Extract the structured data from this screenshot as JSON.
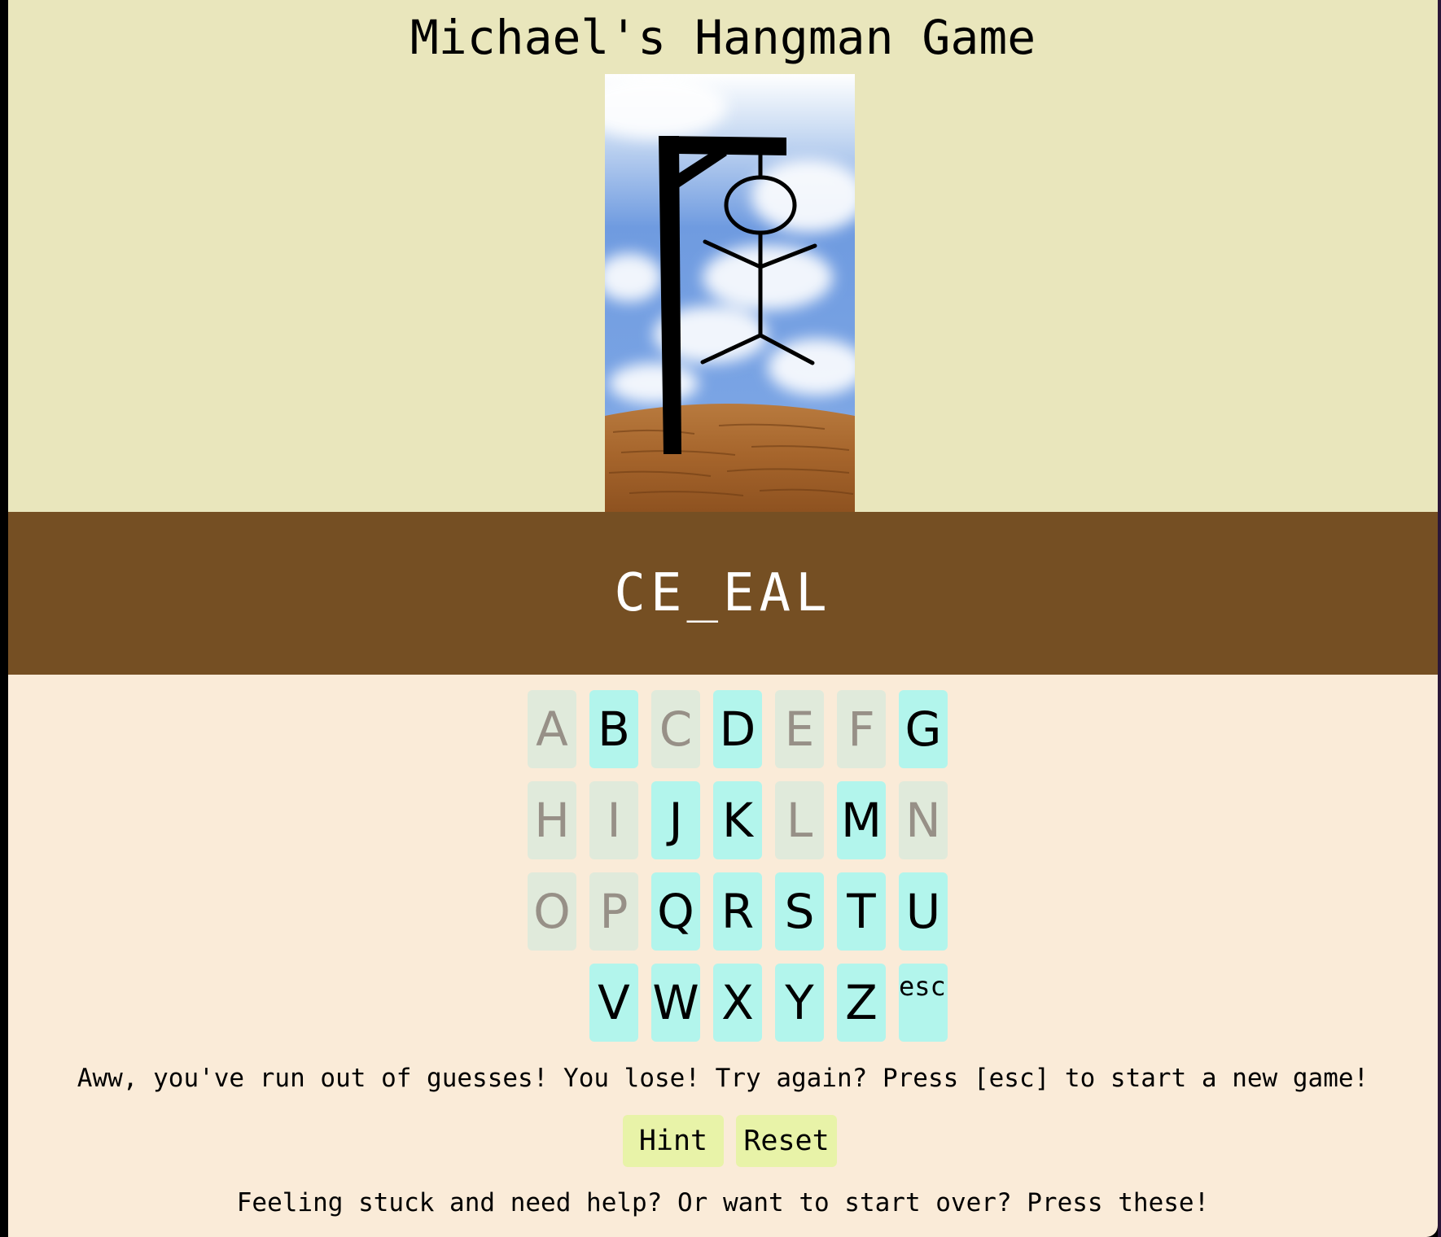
{
  "page": {
    "title": "Michael's Hangman Game"
  },
  "game": {
    "word_display": "CE_EAL",
    "image": "gallows-with-full-stick-figure"
  },
  "keyboard": {
    "rows": [
      [
        {
          "label": "A",
          "used": true
        },
        {
          "label": "B",
          "used": false
        },
        {
          "label": "C",
          "used": true
        },
        {
          "label": "D",
          "used": false
        },
        {
          "label": "E",
          "used": true
        },
        {
          "label": "F",
          "used": true
        },
        {
          "label": "G",
          "used": false
        }
      ],
      [
        {
          "label": "H",
          "used": true
        },
        {
          "label": "I",
          "used": true
        },
        {
          "label": "J",
          "used": false
        },
        {
          "label": "K",
          "used": false
        },
        {
          "label": "L",
          "used": true
        },
        {
          "label": "M",
          "used": false
        },
        {
          "label": "N",
          "used": true
        }
      ],
      [
        {
          "label": "O",
          "used": true
        },
        {
          "label": "P",
          "used": true
        },
        {
          "label": "Q",
          "used": false
        },
        {
          "label": "R",
          "used": false
        },
        {
          "label": "S",
          "used": false
        },
        {
          "label": "T",
          "used": false
        },
        {
          "label": "U",
          "used": false
        }
      ],
      [
        {
          "label": "V",
          "used": false
        },
        {
          "label": "W",
          "used": false
        },
        {
          "label": "X",
          "used": false
        },
        {
          "label": "Y",
          "used": false
        },
        {
          "label": "Z",
          "used": false
        },
        {
          "label": "esc",
          "used": false,
          "special": true
        }
      ]
    ]
  },
  "message": "Aww, you've run out of guesses! You lose! Try again? Press [esc] to start a new game!",
  "buttons": {
    "hint_label": "Hint",
    "reset_label": "Reset"
  },
  "help_text": "Feeling stuck and need help? Or want to start over? Press these!",
  "colors": {
    "hero_background": "#e9e6bc",
    "word_band": "#754f23",
    "page_background": "#faebd8",
    "key_available": "#b2f5ec",
    "key_used": "#e0eadb",
    "key_used_text": "#979087",
    "button": "#e8f3a8"
  }
}
